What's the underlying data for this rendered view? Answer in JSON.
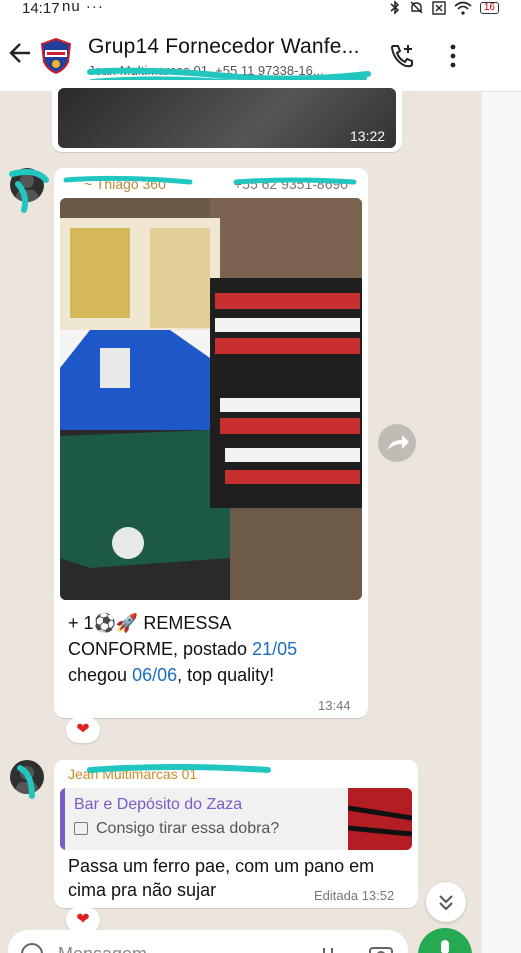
{
  "status_bar": {
    "time": "14:17",
    "carrier_glyphs": "nu",
    "more": "···",
    "battery": "16"
  },
  "header": {
    "title": "Grup14 Fornecedor Wanfe...",
    "subtitle": "Jean Multimarcas 01, +55 11 97338-16..."
  },
  "messages": [
    {
      "type": "image",
      "time": "13:22"
    },
    {
      "type": "image_caption",
      "sender": "~ Thiago 360",
      "phone": "+55 62 9351-8690",
      "caption_line1": "+ 1⚽🚀 REMESSA",
      "caption_line2_a": "CONFORME, postado ",
      "caption_line2_b": "21/05",
      "caption_line3_a": "chegou ",
      "caption_line3_b": "06/06",
      "caption_line3_c": ", top quality!",
      "time": "13:44",
      "reaction": "❤"
    },
    {
      "type": "reply",
      "sender": "Jean Multimarcas 01",
      "quote_name": "Bar e Depósito do Zaza",
      "quote_text": "Consigo tirar essa dobra?",
      "text_line1": "Passa um ferro pae, com um pano em",
      "text_line2": "cima pra não sujar",
      "time": "Editada 13:52",
      "reaction": "❤"
    }
  ],
  "composer": {
    "placeholder": "Mensagem"
  },
  "colors": {
    "accent_green": "#25a952",
    "link_blue": "#1a6ec0",
    "quote_purple": "#7b5bc4",
    "sender_gold": "#b58a3a",
    "scribble_teal": "#21c6c0"
  }
}
